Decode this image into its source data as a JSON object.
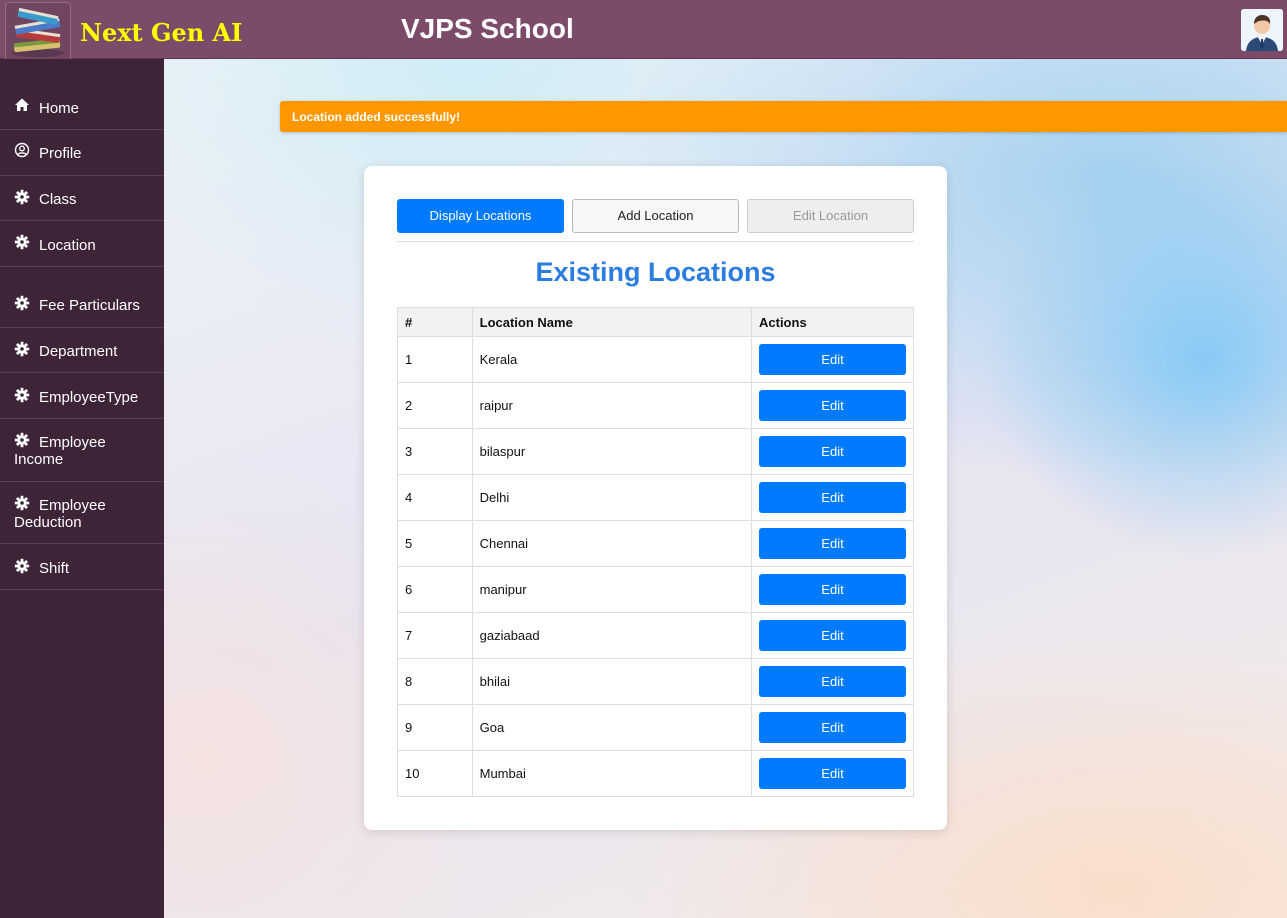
{
  "header": {
    "brand": "Next Gen AI",
    "school_name": "VJPS School"
  },
  "sidebar": {
    "items": [
      {
        "label": "Home",
        "icon": "home-icon"
      },
      {
        "label": "Profile",
        "icon": "user-circle-icon"
      },
      {
        "label": "Class",
        "icon": "gear-icon"
      },
      {
        "label": "Location",
        "icon": "gear-icon"
      },
      {
        "label": "Fee Particulars",
        "icon": "gear-icon"
      },
      {
        "label": "Department",
        "icon": "gear-icon"
      },
      {
        "label": "EmployeeType",
        "icon": "gear-icon"
      },
      {
        "label": "Employee Income",
        "icon": "gear-icon"
      },
      {
        "label": "Employee Deduction",
        "icon": "gear-icon"
      },
      {
        "label": "Shift",
        "icon": "gear-icon"
      }
    ]
  },
  "alert": {
    "message": "Location added successfully!",
    "color": "#ff9800"
  },
  "card": {
    "tabs": [
      {
        "label": "Display Locations",
        "state": "active"
      },
      {
        "label": "Add Location",
        "state": "normal"
      },
      {
        "label": "Edit Location",
        "state": "disabled"
      }
    ],
    "title": "Existing Locations",
    "table": {
      "headers": [
        "#",
        "Location Name",
        "Actions"
      ],
      "rows": [
        {
          "num": "1",
          "name": "Kerala",
          "action": "Edit"
        },
        {
          "num": "2",
          "name": "raipur",
          "action": "Edit"
        },
        {
          "num": "3",
          "name": "bilaspur",
          "action": "Edit"
        },
        {
          "num": "4",
          "name": "Delhi",
          "action": "Edit"
        },
        {
          "num": "5",
          "name": "Chennai",
          "action": "Edit"
        },
        {
          "num": "6",
          "name": "manipur",
          "action": "Edit"
        },
        {
          "num": "7",
          "name": "gaziabaad",
          "action": "Edit"
        },
        {
          "num": "8",
          "name": "bhilai",
          "action": "Edit"
        },
        {
          "num": "9",
          "name": "Goa",
          "action": "Edit"
        },
        {
          "num": "10",
          "name": "Mumbai",
          "action": "Edit"
        }
      ]
    }
  },
  "colors": {
    "header_bg": "#7d4b6a",
    "sidebar_bg": "#3d2438",
    "brand_text": "#ffff00",
    "primary": "#007bff",
    "title": "#2b7de0"
  }
}
